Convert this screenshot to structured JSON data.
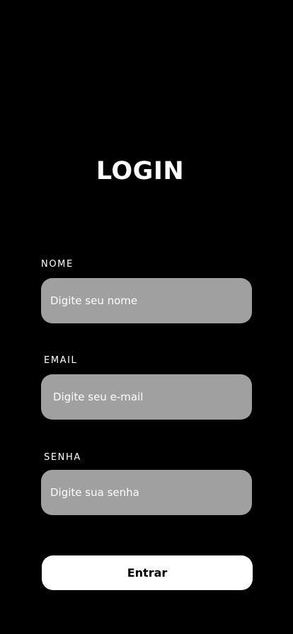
{
  "title": "LOGIN",
  "form": {
    "nome": {
      "label": "NOME",
      "placeholder": "Digite seu nome",
      "value": ""
    },
    "email": {
      "label": "EMAIL",
      "placeholder": "Digite seu e-mail",
      "value": ""
    },
    "senha": {
      "label": "SENHA",
      "placeholder": "Digite sua senha",
      "value": ""
    },
    "submit_label": "Entrar"
  },
  "colors": {
    "background": "#000000",
    "field": "#a0a0a0",
    "button": "#ffffff",
    "text": "#ffffff"
  }
}
